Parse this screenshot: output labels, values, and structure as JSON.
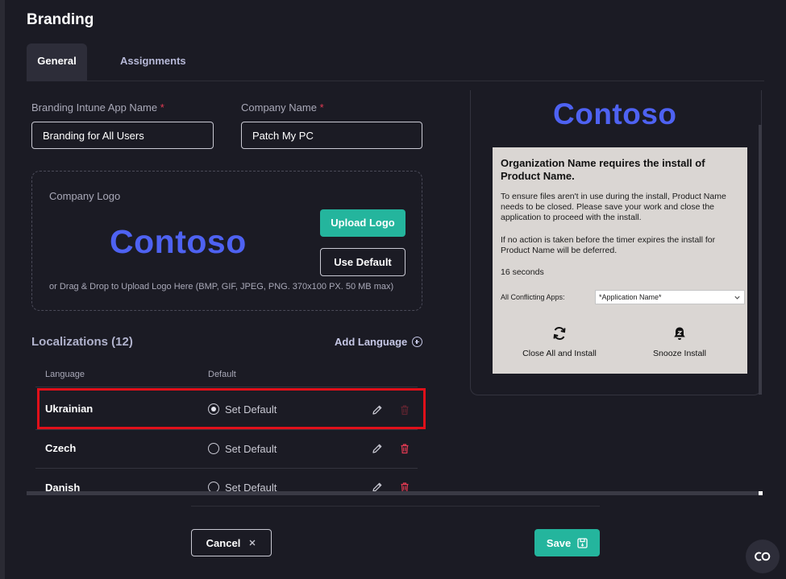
{
  "page": {
    "title": "Branding"
  },
  "tabs": [
    {
      "label": "General",
      "active": true
    },
    {
      "label": "Assignments",
      "active": false
    }
  ],
  "form": {
    "app_name_label": "Branding Intune App Name",
    "app_name_value": "Branding for All Users",
    "company_name_label": "Company Name",
    "company_name_value": "Patch My PC",
    "required_mark": "*"
  },
  "logo": {
    "label": "Company Logo",
    "logo_text": "Contoso",
    "upload_label": "Upload Logo",
    "default_label": "Use Default",
    "hint": "or Drag & Drop to Upload Logo Here (BMP, GIF, JPEG, PNG. 370x100 PX. 50 MB max)"
  },
  "localizations": {
    "title": "Localizations (12)",
    "add_label": "Add Language",
    "col_language": "Language",
    "col_default": "Default",
    "set_default_label": "Set Default",
    "rows": [
      {
        "language": "Ukrainian",
        "is_default": true,
        "delete_enabled": false
      },
      {
        "language": "Czech",
        "is_default": false,
        "delete_enabled": true
      },
      {
        "language": "Danish",
        "is_default": false,
        "delete_enabled": true
      }
    ]
  },
  "preview": {
    "logo_text": "Contoso",
    "title": "Organization Name requires the install of Product Name.",
    "para1": "To ensure files aren't in use during the install, Product Name needs to be closed. Please save your work and close the application to proceed with the install.",
    "para2": "If no action is taken before the timer expires the install for Product Name will be deferred.",
    "timer": "16 seconds",
    "apps_label": "All Conflicting Apps:",
    "apps_value": "*Application Name*",
    "close_install": "Close All and Install",
    "snooze_install": "Snooze Install"
  },
  "footer": {
    "cancel_label": "Cancel",
    "save_label": "Save"
  },
  "colors": {
    "accent": "#24b59d",
    "brand_logo": "#4e62f2",
    "danger": "#e23a52",
    "highlight": "#e0101a",
    "background": "#1b1b24"
  }
}
